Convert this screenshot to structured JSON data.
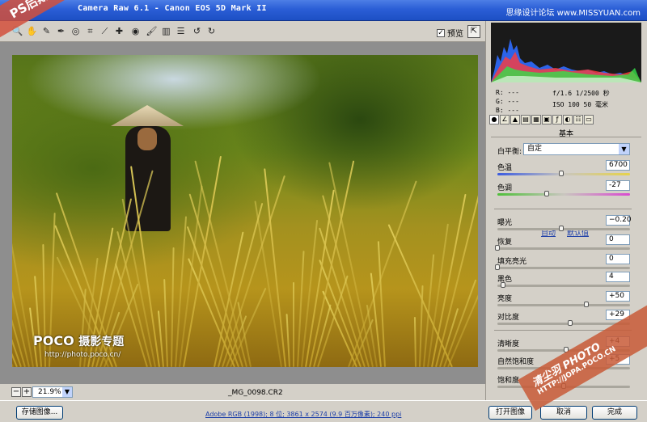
{
  "window": {
    "title": "Camera Raw 6.1 -  Canon EOS 5D Mark II",
    "site_watermark": "思缘设计论坛 www.MISSYUAN.com"
  },
  "toolbar": {
    "preview_label": "预览",
    "preview_checked": "✓"
  },
  "photo": {
    "watermark_brand": "POCO",
    "watermark_brand_sub": "摄影专题",
    "watermark_url": "http://photo.poco.cn/"
  },
  "banners": {
    "top_left": "PS后期调色技巧",
    "bottom_right_1": "清尘羽 PHOTO",
    "bottom_right_2": "HTTP://JOPA.POCO.CN"
  },
  "zoom": {
    "minus": "−",
    "plus": "+",
    "value": "21.9%",
    "arrow": "▼"
  },
  "file": {
    "name": "_MG_0098.CR2"
  },
  "bottom": {
    "save_button": "存储图像...",
    "workflow": "Adobe RGB (1998); 8 位; 3861 x 2574 (9.9 百万像素); 240 ppi",
    "open_button": "打开图像",
    "cancel_button": "取消",
    "done_button": "完成"
  },
  "readout": {
    "r": "R:  ---",
    "g": "G:  ---",
    "b": "B:  ---",
    "aperture_shutter": "f/1.6  1/2500 秒",
    "iso_focal": "ISO 100  50 毫米"
  },
  "panel": {
    "section_title": "基本",
    "wb_label": "白平衡:",
    "wb_value": "自定",
    "wb_arrow": "▼",
    "auto_link": "自动",
    "default_link": "默认值",
    "controls": [
      {
        "label": "色温",
        "value": "6700",
        "level": 0.48
      },
      {
        "label": "色调",
        "value": "-27",
        "level": 0.37
      },
      {
        "label": "曝光",
        "value": "−0.20",
        "level": 0.48
      },
      {
        "label": "恢复",
        "value": "0",
        "level": 0.0
      },
      {
        "label": "填充亮光",
        "value": "0",
        "level": 0.0
      },
      {
        "label": "黑色",
        "value": "4",
        "level": 0.04
      },
      {
        "label": "亮度",
        "value": "+50",
        "level": 0.67
      },
      {
        "label": "对比度",
        "value": "+29",
        "level": 0.55
      },
      {
        "label": "清晰度",
        "value": "+4",
        "level": 0.52
      },
      {
        "label": "自然饱和度",
        "value": "+5",
        "level": 0.52
      },
      {
        "label": "饱和度",
        "value": "",
        "level": 0.5
      }
    ]
  },
  "colors": {
    "titlebar": "#2a5ed6",
    "banner": "#d2503c",
    "link": "#1c3ea8"
  }
}
